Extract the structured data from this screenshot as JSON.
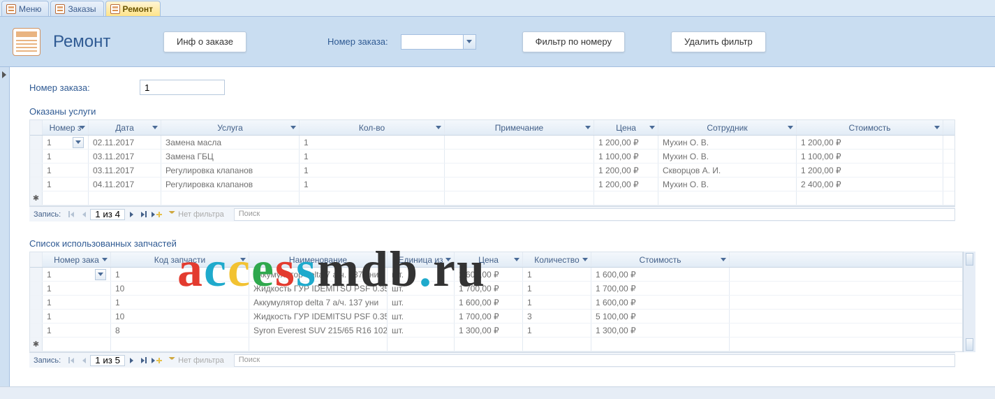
{
  "tabs": [
    {
      "label": "Меню",
      "active": false
    },
    {
      "label": "Заказы",
      "active": false
    },
    {
      "label": "Ремонт",
      "active": true
    }
  ],
  "header": {
    "title": "Ремонт",
    "btn_info": "Инф о заказе",
    "lbl_order_no": "Номер заказа:",
    "combo_value": "",
    "btn_filter": "Фильтр по номеру",
    "btn_clear": "Удалить фильтр"
  },
  "form": {
    "lbl_order_no": "Номер заказа:",
    "order_no_value": "1",
    "section_services": "Оказаны услуги",
    "section_parts": "Список использованных запчастей"
  },
  "services_grid": {
    "columns": [
      "Номер з",
      "Дата",
      "Услуга",
      "Кол-во",
      "Примечание",
      "Цена",
      "Сотрудник",
      "Стоимость"
    ],
    "rows": [
      {
        "no": "1",
        "date": "02.11.2017",
        "service": "Замена масла",
        "qty": "1",
        "note": "",
        "price": "1 200,00 ₽",
        "employee": "Мухин О. В.",
        "cost": "1 200,00 ₽"
      },
      {
        "no": "1",
        "date": "03.11.2017",
        "service": "Замена ГБЦ",
        "qty": "1",
        "note": "",
        "price": "1 100,00 ₽",
        "employee": "Мухин О. В.",
        "cost": "1 100,00 ₽"
      },
      {
        "no": "1",
        "date": "03.11.2017",
        "service": "Регулировка клапанов",
        "qty": "1",
        "note": "",
        "price": "1 200,00 ₽",
        "employee": "Скворцов А. И.",
        "cost": "1 200,00 ₽"
      },
      {
        "no": "1",
        "date": "04.11.2017",
        "service": "Регулировка клапанов",
        "qty": "1",
        "note": "",
        "price": "1 200,00 ₽",
        "employee": "Мухин О. В.",
        "cost": "2 400,00 ₽"
      }
    ],
    "nav": {
      "label": "Запись:",
      "pos": "1 из 4",
      "filter": "Нет фильтра",
      "search": "Поиск"
    }
  },
  "parts_grid": {
    "columns": [
      "Номер зака",
      "Код запчасти",
      "Наименование",
      "Единица из",
      "Цена",
      "Количество",
      "Стоимость"
    ],
    "rows": [
      {
        "no": "1",
        "code": "1",
        "name": "Аккумулятор delta 7 а/ч. 137 уни",
        "unit": "шт.",
        "price": "1 600,00 ₽",
        "qty": "1",
        "cost": "1 600,00 ₽"
      },
      {
        "no": "1",
        "code": "10",
        "name": "Жидкость ГУР IDEMITSU PSF 0.35",
        "unit": "шт.",
        "price": "1 700,00 ₽",
        "qty": "1",
        "cost": "1 700,00 ₽"
      },
      {
        "no": "1",
        "code": "1",
        "name": "Аккумулятор delta 7 а/ч. 137 уни",
        "unit": "шт.",
        "price": "1 600,00 ₽",
        "qty": "1",
        "cost": "1 600,00 ₽"
      },
      {
        "no": "1",
        "code": "10",
        "name": "Жидкость ГУР IDEMITSU PSF 0.35",
        "unit": "шт.",
        "price": "1 700,00 ₽",
        "qty": "3",
        "cost": "5 100,00 ₽"
      },
      {
        "no": "1",
        "code": "8",
        "name": "Syron Everest SUV 215/65 R16 102",
        "unit": "шт.",
        "price": "1 300,00 ₽",
        "qty": "1",
        "cost": "1 300,00 ₽"
      }
    ],
    "nav": {
      "label": "Запись:",
      "pos": "1 из 5",
      "filter": "Нет фильтра",
      "search": "Поиск"
    }
  },
  "watermark": "accessmdb.ru"
}
